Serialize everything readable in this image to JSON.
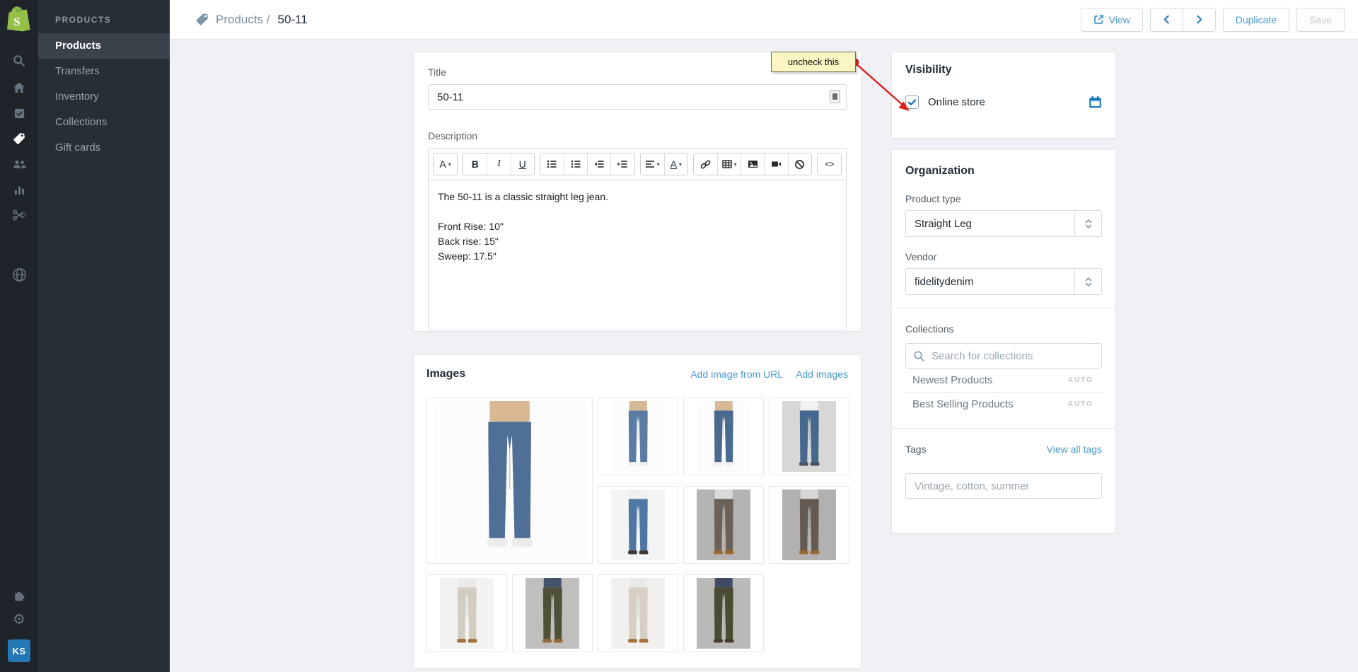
{
  "colors": {
    "brand_green": "#95bf47",
    "accent_blue": "#4898cc",
    "strong_blue": "#1576b7",
    "annotation_yellow": "#fbf6c3",
    "annotation_red": "#dd1f1f",
    "sidebar_dark": "#272e36",
    "rail_dark": "#1e242a"
  },
  "rail": {
    "logo_name": "shopify-logo",
    "top_icons": [
      "search",
      "home",
      "orders",
      "products-tag",
      "customers",
      "reports",
      "discounts"
    ],
    "store_icon": "online-store-globe",
    "bottom_icons": [
      "apps-puzzle",
      "settings-gear"
    ],
    "avatar_initials": "KS"
  },
  "sidebar": {
    "heading": "PRODUCTS",
    "items": [
      {
        "label": "Products",
        "active": true
      },
      {
        "label": "Transfers",
        "active": false
      },
      {
        "label": "Inventory",
        "active": false
      },
      {
        "label": "Collections",
        "active": false
      },
      {
        "label": "Gift cards",
        "active": false
      }
    ]
  },
  "topbar": {
    "breadcrumb": {
      "section": "Products /",
      "current": "50-11"
    },
    "view_label": "View",
    "duplicate_label": "Duplicate",
    "save_label": "Save",
    "save_disabled": true
  },
  "main": {
    "details_card": {
      "title_label": "Title",
      "title_value": "50-11",
      "description_label": "Description",
      "toolbar_groups": [
        [
          "font-style"
        ],
        [
          "bold",
          "italic",
          "underline"
        ],
        [
          "bullet-list",
          "ordered-list",
          "outdent",
          "indent"
        ],
        [
          "align",
          "text-color"
        ],
        [
          "link",
          "table",
          "image",
          "video",
          "clear-formatting"
        ],
        [
          "code"
        ]
      ],
      "description_lines": [
        "The 50-11 is a classic straight leg jean.",
        "",
        "Front Rise: 10\"",
        "Back rise: 15\"",
        "Sweep: 17.5\""
      ]
    },
    "images_card": {
      "heading": "Images",
      "add_from_url_label": "Add image from URL",
      "add_images_label": "Add images",
      "tiles": [
        {
          "desc": "blue jeans front featured",
          "bg": "#fcfcfc",
          "top": "#d9b894",
          "pants": "#4f6f96",
          "shoes": "#ececec"
        },
        {
          "desc": "blue jeans angled",
          "bg": "#fcfcfc",
          "top": "#d9b894",
          "pants": "#5b7ca4",
          "shoes": "#efefef"
        },
        {
          "desc": "blue jeans back",
          "bg": "#fcfcfc",
          "top": "#d9b894",
          "pants": "#4b6a8f",
          "shoes": "#efefef"
        },
        {
          "desc": "blue jeans white tee gray bg",
          "bg": "#d7d7d5",
          "top": "#f1f1ef",
          "pants": "#45688e",
          "shoes": "#4a5568"
        },
        {
          "desc": "blue jeans white tee",
          "bg": "#f3f4f4",
          "top": "#eff0ee",
          "pants": "#4e77a3",
          "shoes": "#3f3a33"
        },
        {
          "desc": "gray brown pants front",
          "bg": "#b5b4b2",
          "top": "#dadad8",
          "pants": "#6b6157",
          "shoes": "#9c6a35"
        },
        {
          "desc": "gray brown pants back",
          "bg": "#b2b1af",
          "top": "#d6d6d4",
          "pants": "#645a52",
          "shoes": "#9a6a36"
        },
        {
          "desc": "cream pants front",
          "bg": "#f3f2f0",
          "top": "#ebebe9",
          "pants": "#d3ccc0",
          "shoes": "#a2713d"
        },
        {
          "desc": "olive pants front",
          "bg": "#c0bfbd",
          "top": "#45536b",
          "pants": "#4e5038",
          "shoes": "#96683a"
        },
        {
          "desc": "khaki pants back",
          "bg": "#f1f0ee",
          "top": "#e9e9e7",
          "pants": "#d6cfc4",
          "shoes": "#a2713d"
        },
        {
          "desc": "olive pants back",
          "bg": "#bab9b7",
          "top": "#3f4c63",
          "pants": "#494c33",
          "shoes": "#4a3c2c"
        }
      ]
    }
  },
  "right_panel": {
    "visibility": {
      "heading": "Visibility",
      "checkbox_label": "Online store",
      "checked": true
    },
    "organization": {
      "heading": "Organization",
      "product_type_label": "Product type",
      "product_type_value": "Straight Leg",
      "vendor_label": "Vendor",
      "vendor_value": "fidelitydenim"
    },
    "collections": {
      "label": "Collections",
      "search_placeholder": "Search for collections",
      "items": [
        {
          "name": "Newest Products",
          "badge": "AUTO"
        },
        {
          "name": "Best Selling Products",
          "badge": "AUTO"
        }
      ]
    },
    "tags": {
      "label": "Tags",
      "view_all_label": "View all tags",
      "placeholder": "Vintage, cotton, summer"
    }
  },
  "annotation": {
    "text": "uncheck this"
  }
}
